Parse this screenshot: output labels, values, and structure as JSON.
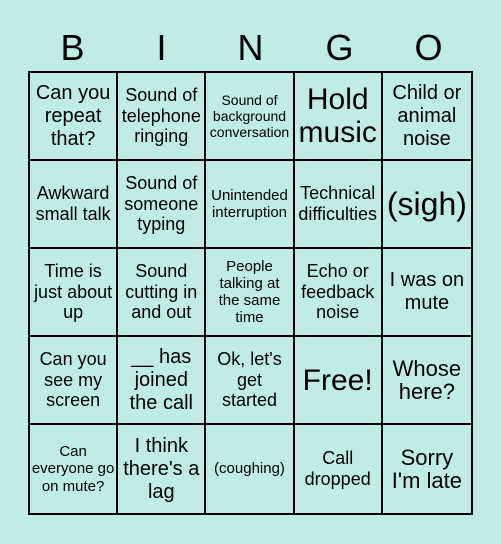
{
  "header": {
    "letters": [
      "B",
      "I",
      "N",
      "G",
      "O"
    ]
  },
  "card": {
    "cells": [
      "Can you repeat that?",
      "Sound of telephone ringing",
      "Sound of background conversation",
      "Hold music",
      "Child or animal noise",
      "Awkward small talk",
      "Sound of someone typing",
      "Unintended interruption",
      "Technical difficulties",
      "(sigh)",
      "Time is just about up",
      "Sound cutting in and out",
      "People talking at the same time",
      "Echo or feedback noise",
      "I was on mute",
      "Can you see my screen",
      "__ has joined the call",
      "Ok, let's get started",
      "Free!",
      "Whose here?",
      "Can everyone go on mute?",
      "I think there's a lag",
      "(coughing)",
      "Call dropped",
      "Sorry I'm late"
    ]
  },
  "colors": {
    "background": "#c0ece5",
    "grid_lines": "#000000",
    "text": "#000000"
  }
}
